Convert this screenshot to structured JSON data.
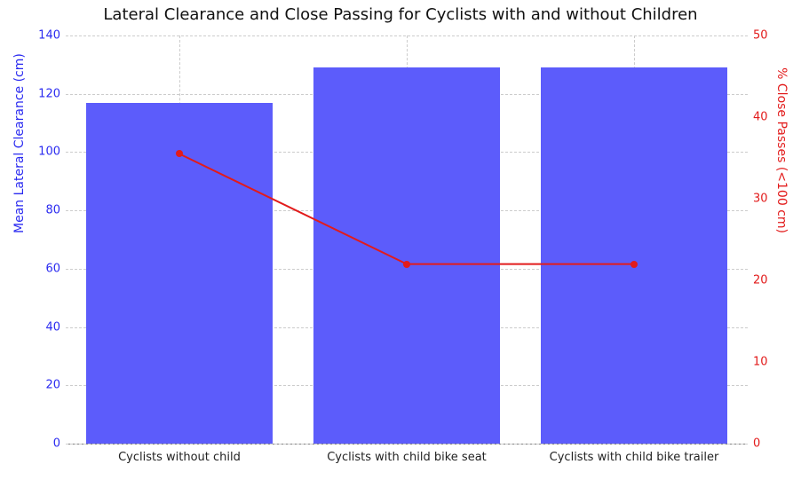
{
  "chart_data": {
    "type": "bar",
    "title": "Lateral Clearance and Close Passing for Cyclists with and without Children",
    "categories": [
      "Cyclists without child",
      "Cyclists with child bike seat",
      "Cyclists with child bike trailer"
    ],
    "series": [
      {
        "name": "Mean Lateral Clearance (cm)",
        "values": [
          117,
          129,
          129
        ],
        "axis": "left",
        "kind": "bar",
        "color": "#5c5cfb"
      },
      {
        "name": "% Close Passes (<100 cm)",
        "values": [
          35.5,
          22,
          22
        ],
        "axis": "right",
        "kind": "line",
        "color": "#e21b1b"
      }
    ],
    "xlabel": "",
    "ylabel_left": "Mean Lateral Clearance (cm)",
    "ylabel_right": "% Close Passes (<100 cm)",
    "ylim_left": [
      0,
      140
    ],
    "ylim_right": [
      0,
      50
    ],
    "yticks_left": [
      0,
      20,
      40,
      60,
      80,
      100,
      120,
      140
    ],
    "yticks_right": [
      0,
      10,
      20,
      30,
      40,
      50
    ]
  }
}
